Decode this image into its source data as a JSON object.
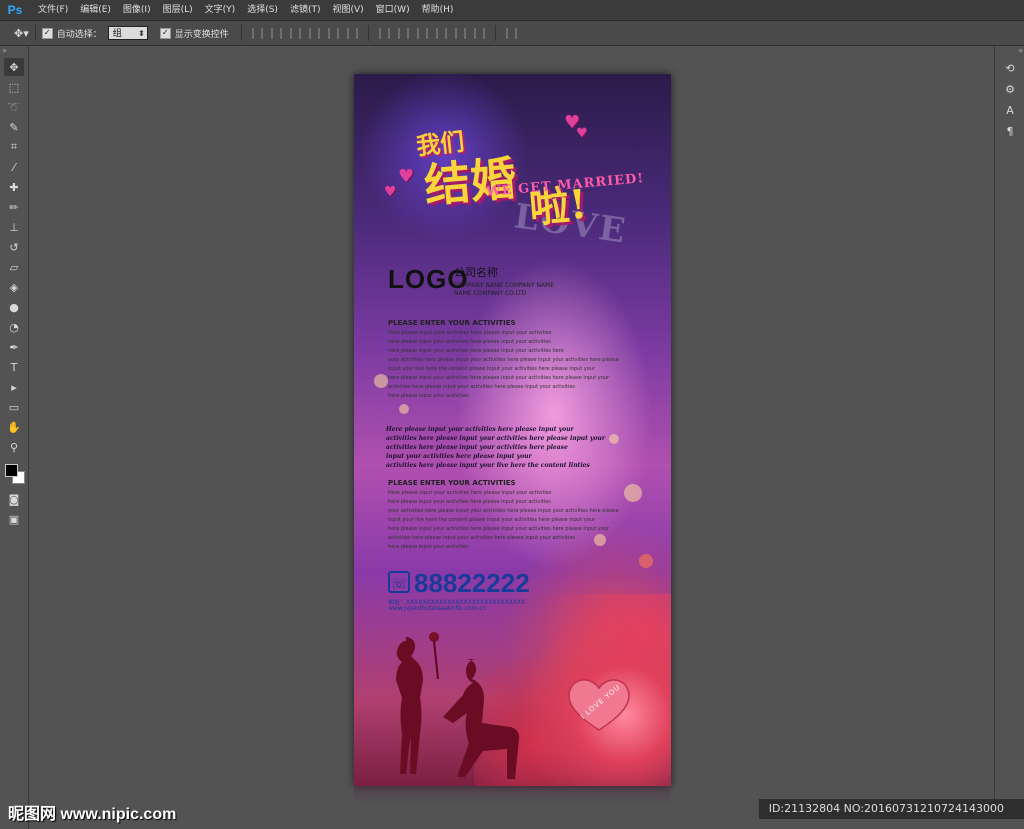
{
  "app": {
    "logo": "Ps"
  },
  "menu": [
    "文件(F)",
    "编辑(E)",
    "图像(I)",
    "图层(L)",
    "文字(Y)",
    "选择(S)",
    "滤镜(T)",
    "视图(V)",
    "窗口(W)",
    "帮助(H)"
  ],
  "options": {
    "auto_select_label": "自动选择：",
    "auto_select_value": "组",
    "show_transform_label": "显示变换控件"
  },
  "poster": {
    "title_a": "我们",
    "title_b": "结婚",
    "title_c": "啦!",
    "title_en": "WE GET MARRIED!",
    "title_bg": "LOVE",
    "logo": "LOGO",
    "company_cn": "公司名称",
    "company_en1": "COMPANY NAME COMPANY NAME",
    "company_en2": "NAME COMPANY CO.LTD",
    "section1_head": "PLEASE ENTER YOUR ACTIVITIES",
    "section1_lines": [
      "Here please input your activities here please input your activities",
      "here please input your activities here please input your activities",
      "here please input your activities here please input your activities here",
      "your activities here please input your activities here please input your activities here please",
      "input your live here the content please input your activities here please input your",
      "here please input your activities here please input your activities here please input your",
      "activities here please input your activities here please input your activities",
      "here please input your activities"
    ],
    "script_lines": [
      "Here please input your activities here please input your",
      "activities here please input your activities here please input your",
      "activities here please input your activities here please",
      "input your activities here please input your",
      "activities here please input your live here the content linties"
    ],
    "section2_head": "PLEASE ENTER YOUR ACTIVITIES",
    "section2_lines": [
      "Here please input your activities here please input your activities",
      "here please input your activities here please input your activities",
      "your activities here please input your activities here please input your activities here please",
      "input your live here the content please input your activities here please input your",
      "here please input your activities here please input your activities here please input your",
      "activities here please input your activities here please input your activities",
      "here please input your activities"
    ],
    "phone": "88822222",
    "address": "地址：XXXXXXXXXXXXXXXXXXXXXXXXXXXXX",
    "website": "www.jvjskdhsfaksaakhfik.com.cn",
    "heart_text": "I LOVE YOU"
  },
  "watermark": {
    "left": "昵图网 www.nipic.com",
    "right": "ID:21132804 NO:20160731210724143000"
  }
}
